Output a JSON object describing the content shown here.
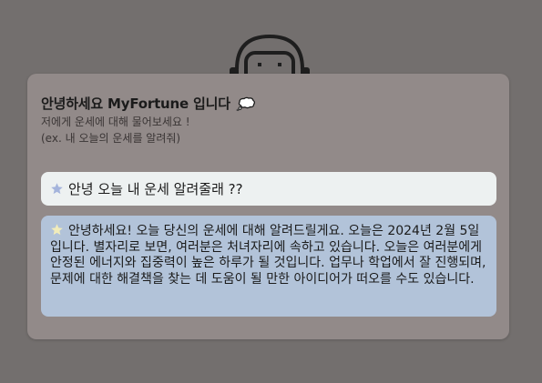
{
  "header": {
    "title": "안녕하세요 MyFortune 입니다",
    "subtitle_line1": "저에게 운세에 대해 물어보세요 !",
    "subtitle_line2": "(ex. 내 오늘의 운세를 알려줘)",
    "title_icon": "speech-bubble-icon"
  },
  "conversation": {
    "messages": [
      {
        "role": "user",
        "icon": "star-icon",
        "icon_color": "#a4b4dc",
        "text": "안녕 오늘 내 운세 알려줄래 ??"
      },
      {
        "role": "assistant",
        "icon": "star-icon",
        "icon_color": "#f1ecba",
        "text": "안녕하세요! 오늘 당신의 운세에 대해 알려드릴게요. 오늘은 2024년 2월 5일입니다. 별자리로 보면, 여러분은 처녀자리에 속하고 있습니다. 오늘은 여러분에게 안정된 에너지와 집중력이 높은 하루가 될 것입니다. 업무나 학업에서 잘 진행되며, 문제에 대한 해결책을 찾는 데 도움이 될 만한 아이디어가 떠오를 수도 있습니다."
      }
    ]
  },
  "colors": {
    "page_background": "#736f6e",
    "card_background": "#928a89",
    "user_bubble": "#edf1f1",
    "assistant_bubble": "#b2c3d9"
  }
}
